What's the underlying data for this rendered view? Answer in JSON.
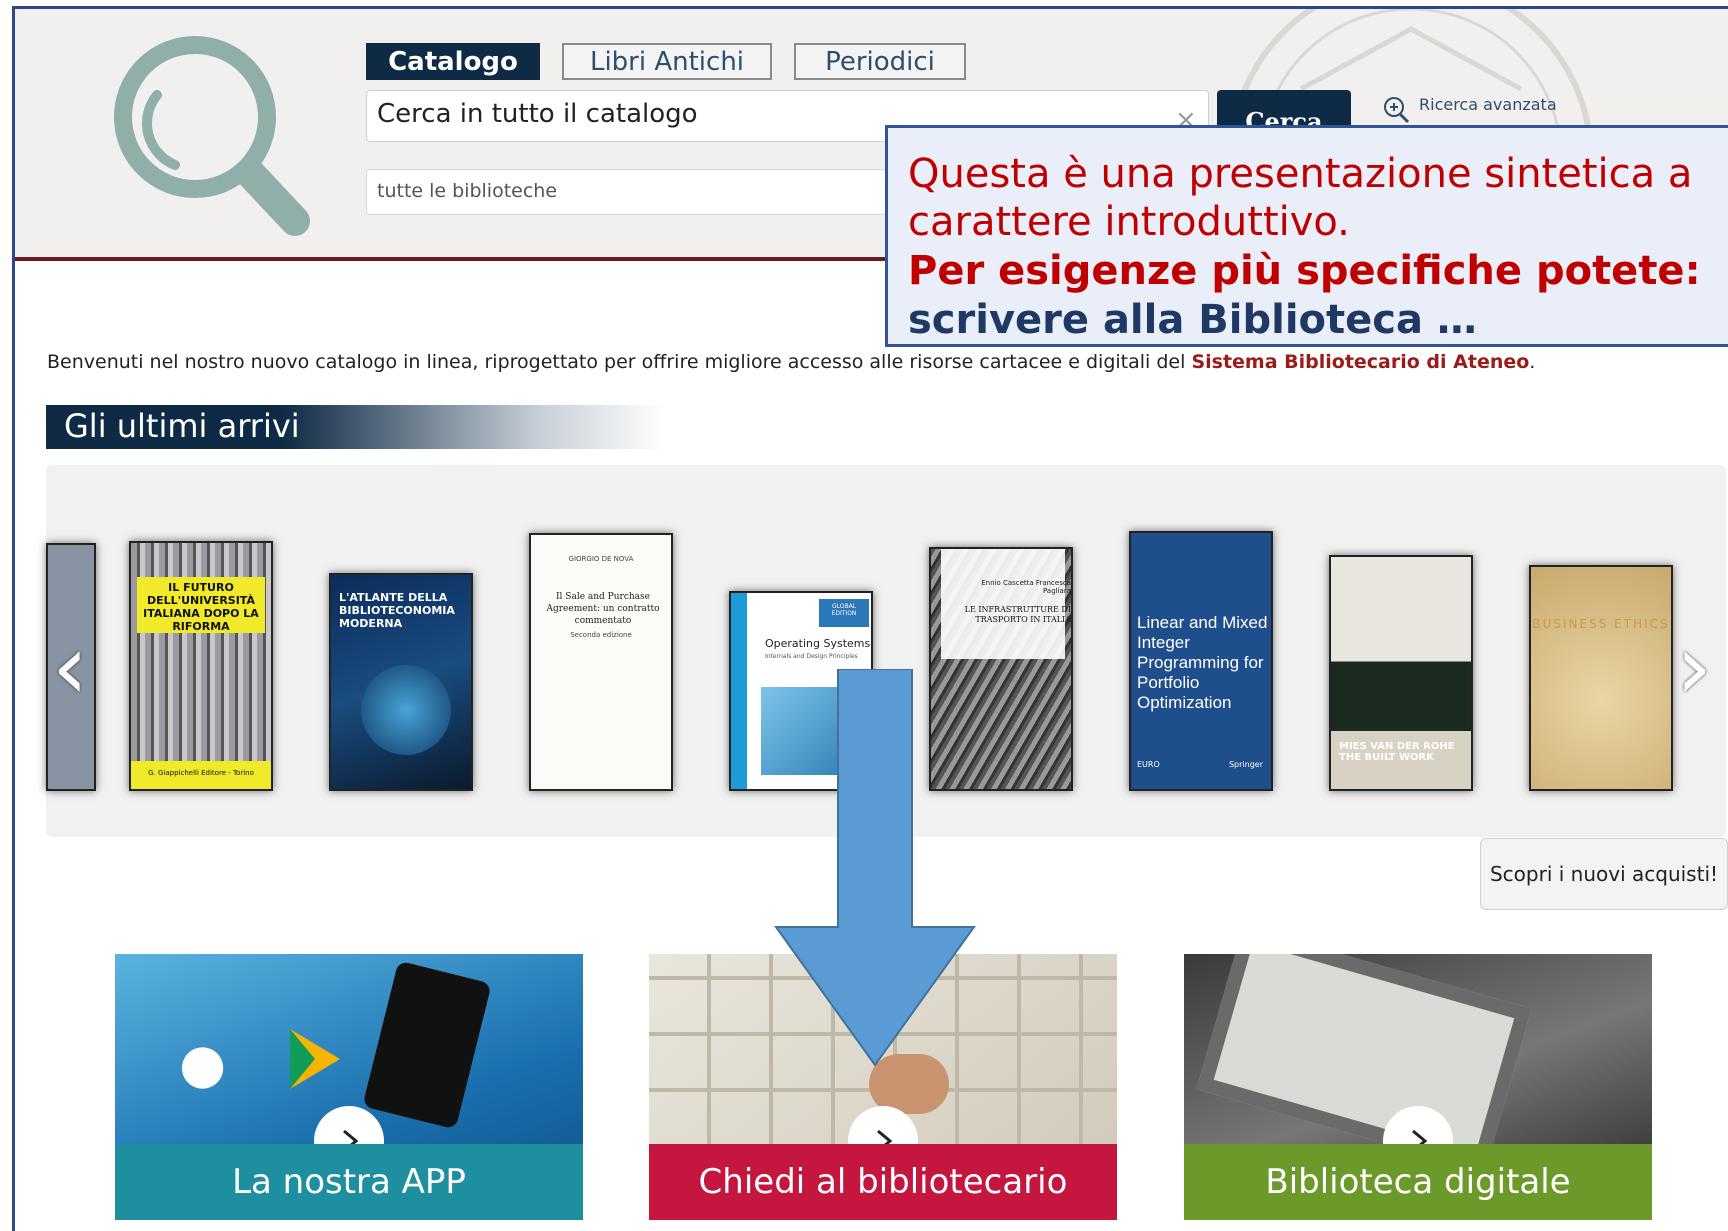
{
  "header": {
    "tabs": [
      {
        "label": "Catalogo",
        "active": true
      },
      {
        "label": "Libri Antichi",
        "active": false
      },
      {
        "label": "Periodici",
        "active": false
      }
    ],
    "search_value": "Cerca in tutto il catalogo",
    "clear_symbol": "×",
    "search_button": "Cerca",
    "advanced_search": "Ricerca avanzata",
    "library_scope": "tutte le biblioteche"
  },
  "callout": {
    "line1": "Questa è una presentazione sintetica a",
    "line2": "carattere introduttivo.",
    "line3": "Per esigenze più specifiche potete:",
    "line4": "scrivere alla Biblioteca …"
  },
  "welcome": {
    "text": "Benvenuti nel nostro nuovo catalogo in linea, riprogettato per offrire migliore accesso alle risorse cartacee e digitali del ",
    "link": "Sistema Bibliotecario di Ateneo",
    "suffix": "."
  },
  "arrivals": {
    "title": "Gli ultimi arrivi",
    "books": [
      {
        "title": "IL FUTURO DELL'UNIVERSITÀ ITALIANA DOPO LA RIFORMA",
        "publisher": "G. Giappichelli Editore - Torino"
      },
      {
        "title": "L'ATLANTE DELLA BIBLIOTECONOMIA MODERNA"
      },
      {
        "author": "GIORGIO DE NOVA",
        "title": "Il Sale and Purchase Agreement: un contratto commentato",
        "edition": "Seconda edizione"
      },
      {
        "title": "Operating Systems",
        "subtitle": "Internals and Design Principles",
        "badge": "GLOBAL EDITION"
      },
      {
        "authors": "Ennio Cascetta Francesca Pagliara",
        "title": "LE INFRASTRUTTURE DI TRASPORTO IN ITALIA"
      },
      {
        "title": "Linear and Mixed Integer Programming for Portfolio Optimization",
        "publisher": "Springer",
        "series": "EURO"
      },
      {
        "title": "MIES VAN DER ROHE THE BUILT WORK"
      },
      {
        "title": "BUSINESS ETHICS"
      }
    ],
    "prev_symbol": "‹",
    "next_symbol": "›"
  },
  "discover_button": "Scopri i nuovi acquisti!",
  "tiles": [
    {
      "label": "La nostra APP",
      "color": "#1e8f9f"
    },
    {
      "label": "Chiedi al bibliotecario",
      "color": "#c4163f"
    },
    {
      "label": "Biblioteca digitale",
      "color": "#6c9a2a"
    }
  ],
  "colors": {
    "navy": "#0e2a44",
    "callout_red": "#c00000",
    "callout_blue": "#1f3864",
    "arrow_blue": "#5b9bd5"
  }
}
